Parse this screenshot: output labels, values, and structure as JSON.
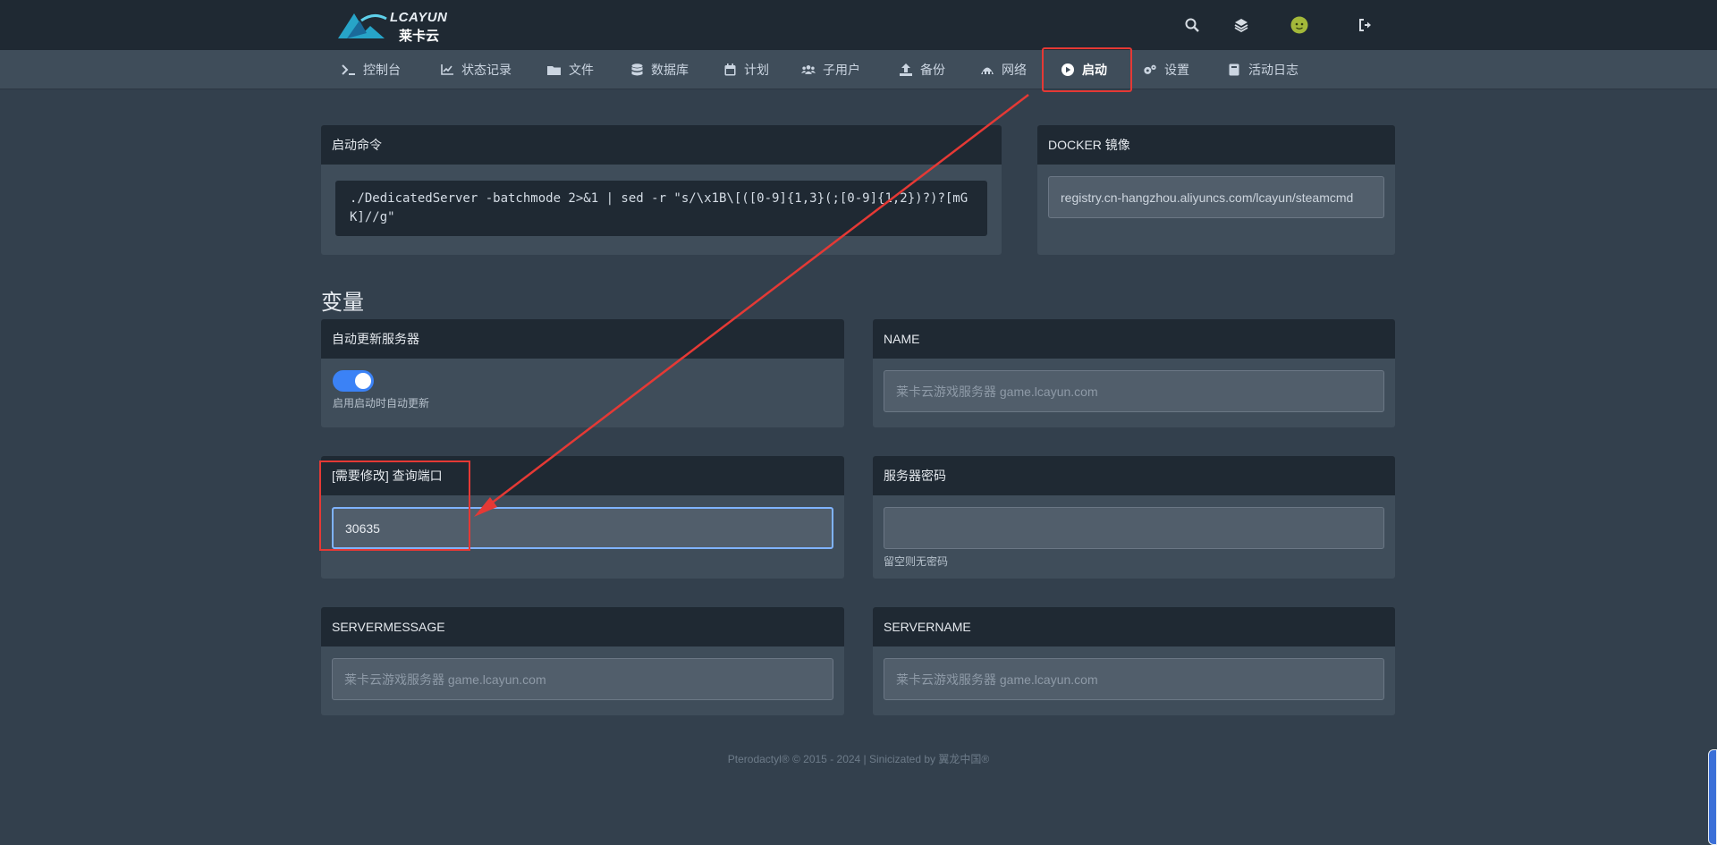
{
  "header": {
    "logo_text_top": "LCAYUN",
    "logo_text_bottom": "莱卡云",
    "icons": [
      "search-icon",
      "layers-icon",
      "avatar",
      "logout-icon"
    ]
  },
  "nav": {
    "items": [
      {
        "label": "控制台",
        "icon": "terminal-icon"
      },
      {
        "label": "状态记录",
        "icon": "chart-icon"
      },
      {
        "label": "文件",
        "icon": "folder-icon"
      },
      {
        "label": "数据库",
        "icon": "database-icon"
      },
      {
        "label": "计划",
        "icon": "calendar-icon"
      },
      {
        "label": "子用户",
        "icon": "users-icon"
      },
      {
        "label": "备份",
        "icon": "upload-icon"
      },
      {
        "label": "网络",
        "icon": "network-icon"
      },
      {
        "label": "启动",
        "icon": "play-icon",
        "active": true
      },
      {
        "label": "设置",
        "icon": "gears-icon"
      },
      {
        "label": "活动日志",
        "icon": "book-icon"
      }
    ]
  },
  "startup": {
    "title": "启动命令",
    "command": "./DedicatedServer -batchmode 2>&1 | sed -r \"s/\\x1B\\[([0-9]{1,3}(;[0-9]{1,2})?)?[mGK]//g\""
  },
  "docker": {
    "title": "DOCKER 镜像",
    "value": "registry.cn-hangzhou.aliyuncs.com/lcayun/steamcmd"
  },
  "variables": {
    "section_title": "变量",
    "auto_update": {
      "title": "自动更新服务器",
      "enabled": true,
      "hint": "启用启动时自动更新"
    },
    "name": {
      "title": "NAME",
      "placeholder": "莱卡云游戏服务器 game.lcayun.com"
    },
    "query_port": {
      "title": "[需要修改] 查询端口",
      "value": "30635"
    },
    "server_password": {
      "title": "服务器密码",
      "value": "",
      "hint": "留空则无密码"
    },
    "servermessage": {
      "title": "SERVERMESSAGE",
      "placeholder": "莱卡云游戏服务器 game.lcayun.com"
    },
    "servername": {
      "title": "SERVERNAME",
      "placeholder": "莱卡云游戏服务器 game.lcayun.com"
    }
  },
  "footer": {
    "text": "Pterodactyl® © 2015 - 2024 | Sinicizated by 翼龙中国®"
  },
  "colors": {
    "annotation": "#e53935",
    "accent": "#3b82f6"
  }
}
